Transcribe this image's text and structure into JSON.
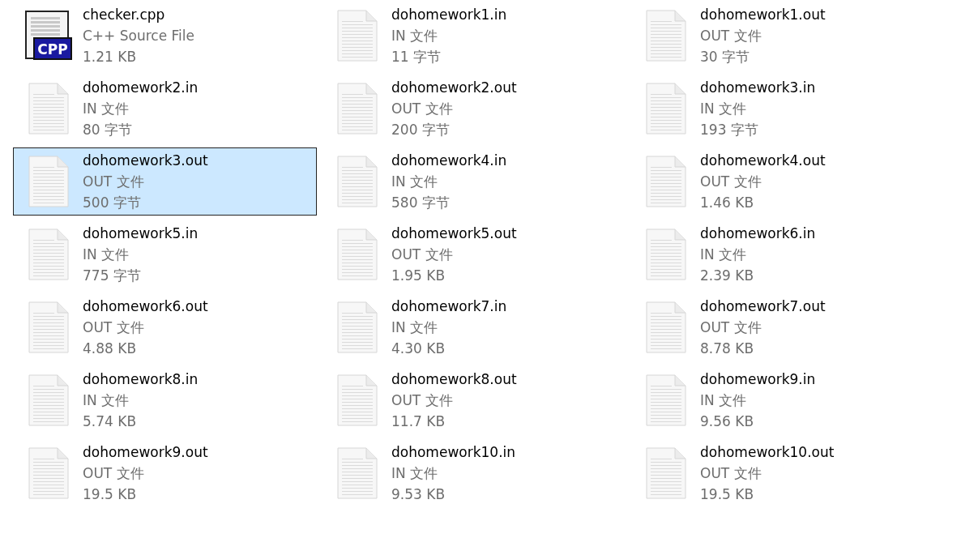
{
  "files": [
    {
      "kind": "cpp",
      "icon_label": "CPP",
      "name": "checker.cpp",
      "type": "C++ Source File",
      "size": "1.21 KB",
      "selected": false
    },
    {
      "kind": "text",
      "name": "dohomework1.in",
      "type": "IN 文件",
      "size": "11 字节",
      "selected": false
    },
    {
      "kind": "text",
      "name": "dohomework1.out",
      "type": "OUT 文件",
      "size": "30 字节",
      "selected": false
    },
    {
      "kind": "text",
      "name": "dohomework2.in",
      "type": "IN 文件",
      "size": "80 字节",
      "selected": false
    },
    {
      "kind": "text",
      "name": "dohomework2.out",
      "type": "OUT 文件",
      "size": "200 字节",
      "selected": false
    },
    {
      "kind": "text",
      "name": "dohomework3.in",
      "type": "IN 文件",
      "size": "193 字节",
      "selected": false
    },
    {
      "kind": "text",
      "name": "dohomework3.out",
      "type": "OUT 文件",
      "size": "500 字节",
      "selected": true
    },
    {
      "kind": "text",
      "name": "dohomework4.in",
      "type": "IN 文件",
      "size": "580 字节",
      "selected": false
    },
    {
      "kind": "text",
      "name": "dohomework4.out",
      "type": "OUT 文件",
      "size": "1.46 KB",
      "selected": false
    },
    {
      "kind": "text",
      "name": "dohomework5.in",
      "type": "IN 文件",
      "size": "775 字节",
      "selected": false
    },
    {
      "kind": "text",
      "name": "dohomework5.out",
      "type": "OUT 文件",
      "size": "1.95 KB",
      "selected": false
    },
    {
      "kind": "text",
      "name": "dohomework6.in",
      "type": "IN 文件",
      "size": "2.39 KB",
      "selected": false
    },
    {
      "kind": "text",
      "name": "dohomework6.out",
      "type": "OUT 文件",
      "size": "4.88 KB",
      "selected": false
    },
    {
      "kind": "text",
      "name": "dohomework7.in",
      "type": "IN 文件",
      "size": "4.30 KB",
      "selected": false
    },
    {
      "kind": "text",
      "name": "dohomework7.out",
      "type": "OUT 文件",
      "size": "8.78 KB",
      "selected": false
    },
    {
      "kind": "text",
      "name": "dohomework8.in",
      "type": "IN 文件",
      "size": "5.74 KB",
      "selected": false
    },
    {
      "kind": "text",
      "name": "dohomework8.out",
      "type": "OUT 文件",
      "size": "11.7 KB",
      "selected": false
    },
    {
      "kind": "text",
      "name": "dohomework9.in",
      "type": "IN 文件",
      "size": "9.56 KB",
      "selected": false
    },
    {
      "kind": "text",
      "name": "dohomework9.out",
      "type": "OUT 文件",
      "size": "19.5 KB",
      "selected": false
    },
    {
      "kind": "text",
      "name": "dohomework10.in",
      "type": "IN 文件",
      "size": "9.53 KB",
      "selected": false
    },
    {
      "kind": "text",
      "name": "dohomework10.out",
      "type": "OUT 文件",
      "size": "19.5 KB",
      "selected": false
    }
  ]
}
